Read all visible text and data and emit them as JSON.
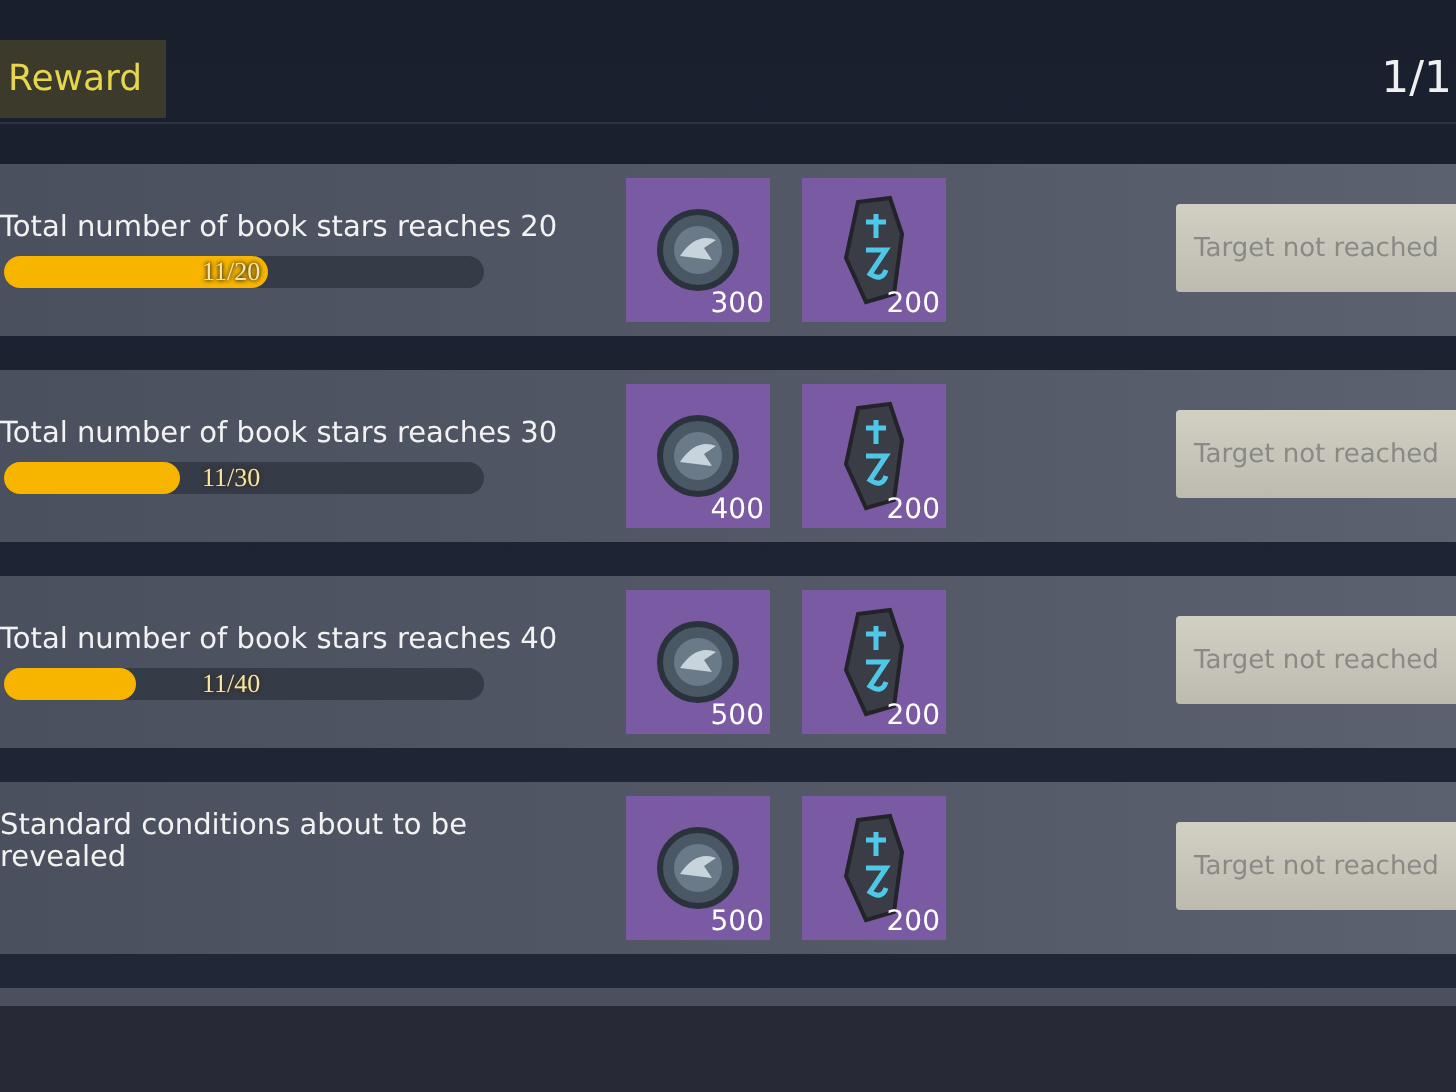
{
  "header": {
    "tab": "Reward",
    "page": "1/1"
  },
  "rows": [
    {
      "condition": "Total number of book stars reaches 20",
      "progress": {
        "level": 0.55,
        "reading": "11/20"
      },
      "rewards": [
        {
          "kind": "coin",
          "count": "300"
        },
        {
          "kind": "rune",
          "count": "200"
        }
      ],
      "button": "Target not reached"
    },
    {
      "condition": "Total number of book stars reaches 30",
      "progress": {
        "level": 0.367,
        "reading": "11/30"
      },
      "rewards": [
        {
          "kind": "coin",
          "count": "400"
        },
        {
          "kind": "rune",
          "count": "200"
        }
      ],
      "button": "Target not reached"
    },
    {
      "condition": "Total number of book stars reaches 40",
      "progress": {
        "level": 0.275,
        "reading": "11/40"
      },
      "rewards": [
        {
          "kind": "coin",
          "count": "500"
        },
        {
          "kind": "rune",
          "count": "200"
        }
      ],
      "button": "Target not reached"
    },
    {
      "condition": "Standard conditions about to be revealed",
      "rewards": [
        {
          "kind": "coin",
          "count": "500"
        },
        {
          "kind": "rune",
          "count": "200"
        }
      ],
      "button": "Target not reached"
    }
  ]
}
